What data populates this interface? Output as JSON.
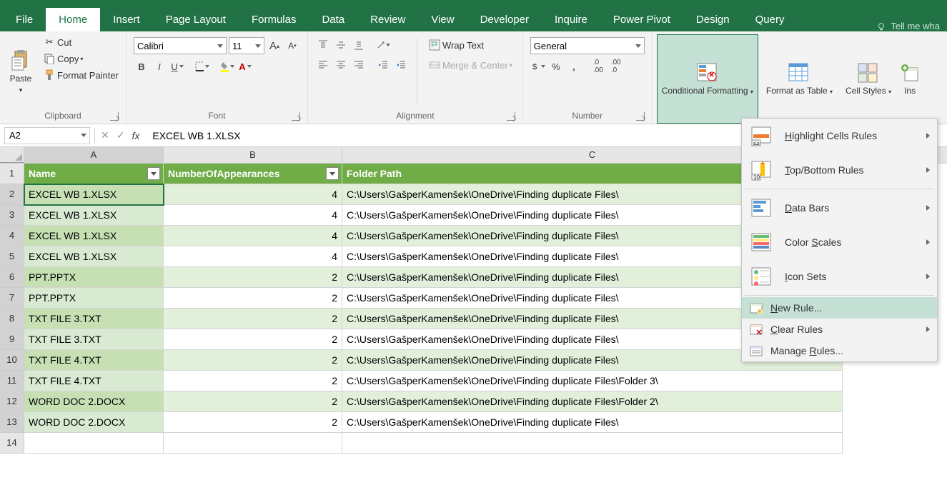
{
  "tabs": [
    "File",
    "Home",
    "Insert",
    "Page Layout",
    "Formulas",
    "Data",
    "Review",
    "View",
    "Developer",
    "Inquire",
    "Power Pivot",
    "Design",
    "Query"
  ],
  "active_tab": "Home",
  "tell_me": "Tell me wha",
  "clipboard": {
    "paste": "Paste",
    "cut": "Cut",
    "copy": "Copy",
    "fp": "Format Painter",
    "label": "Clipboard"
  },
  "font": {
    "name": "Calibri",
    "size": "11",
    "label": "Font"
  },
  "alignment": {
    "wrap": "Wrap Text",
    "merge": "Merge & Center",
    "label": "Alignment"
  },
  "number": {
    "format": "General",
    "label": "Number"
  },
  "styles": {
    "cf": "Conditional Formatting",
    "fmt": "Format as Table",
    "cell": "Cell Styles",
    "ins": "Ins"
  },
  "cf_menu": {
    "hl": "ighlight Cells Rules",
    "hl_u": "H",
    "tb": "op/Bottom Rules",
    "tb_u": "T",
    "db": "ata Bars",
    "db_u": "D",
    "cs": "cales",
    "cs_pre": "Color ",
    "cs_u": "S",
    "is": "con Sets",
    "is_u": "I",
    "nr": "ew Rule...",
    "nr_u": "N",
    "cr": "lear Rules",
    "cr_u": "C",
    "mr": "ules...",
    "mr_pre": "Manage ",
    "mr_u": "R"
  },
  "name_box": "A2",
  "formula": "EXCEL WB 1.XLSX",
  "cols": {
    "A": 195,
    "B": 250,
    "C": 700
  },
  "headers": {
    "A": "Name",
    "B": "NumberOfAppearances",
    "C": "Folder Path"
  },
  "rows": [
    {
      "n": "EXCEL WB 1.XLSX",
      "c": 4,
      "p": "C:\\Users\\GašperKamenšek\\OneDrive\\Finding duplicate Files\\"
    },
    {
      "n": "EXCEL WB 1.XLSX",
      "c": 4,
      "p": "C:\\Users\\GašperKamenšek\\OneDrive\\Finding duplicate Files\\"
    },
    {
      "n": "EXCEL WB 1.XLSX",
      "c": 4,
      "p": "C:\\Users\\GašperKamenšek\\OneDrive\\Finding duplicate Files\\"
    },
    {
      "n": "EXCEL WB 1.XLSX",
      "c": 4,
      "p": "C:\\Users\\GašperKamenšek\\OneDrive\\Finding duplicate Files\\"
    },
    {
      "n": "PPT.PPTX",
      "c": 2,
      "p": "C:\\Users\\GašperKamenšek\\OneDrive\\Finding duplicate Files\\"
    },
    {
      "n": "PPT.PPTX",
      "c": 2,
      "p": "C:\\Users\\GašperKamenšek\\OneDrive\\Finding duplicate Files\\"
    },
    {
      "n": "TXT FILE 3.TXT",
      "c": 2,
      "p": "C:\\Users\\GašperKamenšek\\OneDrive\\Finding duplicate Files\\"
    },
    {
      "n": "TXT FILE 3.TXT",
      "c": 2,
      "p": "C:\\Users\\GašperKamenšek\\OneDrive\\Finding duplicate Files\\"
    },
    {
      "n": "TXT FILE 4.TXT",
      "c": 2,
      "p": "C:\\Users\\GašperKamenšek\\OneDrive\\Finding duplicate Files\\"
    },
    {
      "n": "TXT FILE 4.TXT",
      "c": 2,
      "p": "C:\\Users\\GašperKamenšek\\OneDrive\\Finding duplicate Files\\Folder 3\\"
    },
    {
      "n": "WORD DOC 2.DOCX",
      "c": 2,
      "p": "C:\\Users\\GašperKamenšek\\OneDrive\\Finding duplicate Files\\Folder 2\\"
    },
    {
      "n": "WORD DOC 2.DOCX",
      "c": 2,
      "p": "C:\\Users\\GašperKamenšek\\OneDrive\\Finding duplicate Files\\"
    }
  ]
}
